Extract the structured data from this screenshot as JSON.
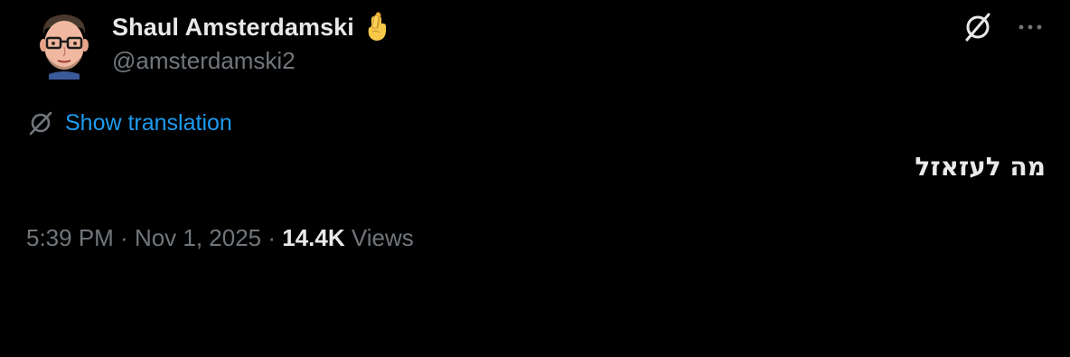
{
  "author": {
    "display_name": "Shaul Amsterdamski",
    "handle": "@amsterdamski2",
    "emoji": "crossed-fingers-emoji"
  },
  "translate": {
    "label": "Show translation",
    "icon": "translate-globe-icon"
  },
  "tweet": {
    "text": "מה לעזאזל"
  },
  "meta": {
    "time": "5:39 PM",
    "separator": " · ",
    "date": "Nov 1, 2025",
    "views_count": "14.4K",
    "views_label": " Views"
  },
  "actions": {
    "grok_icon": "grok-icon",
    "more_icon": "more-options-icon"
  },
  "colors": {
    "background": "#000000",
    "text": "#e7e9ea",
    "secondary": "#71767b",
    "link": "#1d9bf0"
  }
}
